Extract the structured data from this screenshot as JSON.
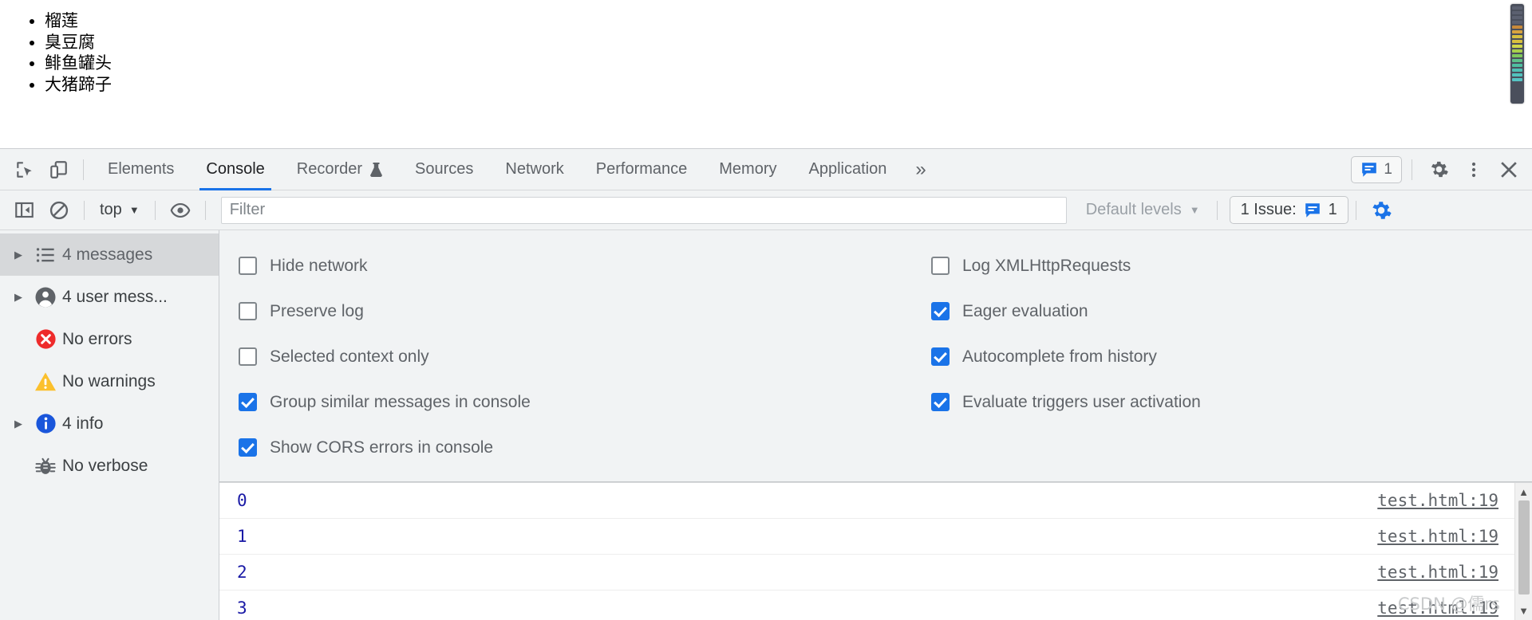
{
  "page": {
    "list_items": [
      "榴莲",
      "臭豆腐",
      "鲱鱼罐头",
      "大猪蹄子"
    ],
    "minimap_colors": [
      "#5b6070",
      "#5b6070",
      "#5b6070",
      "#5b6070",
      "#c98a3a",
      "#d8a33f",
      "#d8c03f",
      "#d8c03f",
      "#cfd84a",
      "#a8d04c",
      "#7fc95c",
      "#5cc28a",
      "#4fbfa0",
      "#4fc0b4",
      "#52c2bd",
      "#55c4c4"
    ]
  },
  "tabbar": {
    "inspect_icon": "inspect-element-icon",
    "device_icon": "device-toolbar-icon",
    "tabs": [
      {
        "label": "Elements",
        "active": false,
        "flask": false
      },
      {
        "label": "Console",
        "active": true,
        "flask": false
      },
      {
        "label": "Recorder",
        "active": false,
        "flask": true
      },
      {
        "label": "Sources",
        "active": false,
        "flask": false
      },
      {
        "label": "Network",
        "active": false,
        "flask": false
      },
      {
        "label": "Performance",
        "active": false,
        "flask": false
      },
      {
        "label": "Memory",
        "active": false,
        "flask": false
      },
      {
        "label": "Application",
        "active": false,
        "flask": false
      }
    ],
    "more_tabs": "»",
    "issues_badge_count": "1",
    "settings_icon": "gear-icon",
    "kebab_icon": "more-options-icon",
    "close_icon": "close-icon"
  },
  "filterbar": {
    "sidebar_toggle_icon": "console-sidebar-toggle-icon",
    "clear_icon": "clear-console-icon",
    "context": "top",
    "context_caret": "▼",
    "eye_icon": "live-expression-icon",
    "filter_value": "",
    "filter_placeholder": "Filter",
    "levels_label": "Default levels",
    "levels_caret": "▼",
    "issue_counter_label": "1 Issue:",
    "issue_counter_count": "1",
    "settings_gear_icon": "console-settings-gear-icon",
    "accent_color": "#1a73e8"
  },
  "sidebar": {
    "items": [
      {
        "label": "4 messages",
        "icon": "list-icon",
        "arrow": true,
        "selected": true
      },
      {
        "label": "4 user mess...",
        "icon": "user-icon",
        "arrow": true,
        "selected": false
      },
      {
        "label": "No errors",
        "icon": "error-icon",
        "arrow": false,
        "selected": false
      },
      {
        "label": "No warnings",
        "icon": "warning-icon",
        "arrow": false,
        "selected": false
      },
      {
        "label": "4 info",
        "icon": "info-icon",
        "arrow": true,
        "selected": false
      },
      {
        "label": "No verbose",
        "icon": "bug-icon",
        "arrow": false,
        "selected": false
      }
    ]
  },
  "settings": {
    "left_column": [
      {
        "label": "Hide network",
        "checked": false
      },
      {
        "label": "Preserve log",
        "checked": false
      },
      {
        "label": "Selected context only",
        "checked": false
      },
      {
        "label": "Group similar messages in console",
        "checked": true
      },
      {
        "label": "Show CORS errors in console",
        "checked": true
      }
    ],
    "right_column": [
      {
        "label": "Log XMLHttpRequests",
        "checked": false
      },
      {
        "label": "Eager evaluation",
        "checked": true
      },
      {
        "label": "Autocomplete from history",
        "checked": true
      },
      {
        "label": "Evaluate triggers user activation",
        "checked": true
      }
    ]
  },
  "console_log": {
    "rows": [
      {
        "value": "0",
        "source": "test.html:19"
      },
      {
        "value": "1",
        "source": "test.html:19"
      },
      {
        "value": "2",
        "source": "test.html:19"
      },
      {
        "value": "3",
        "source": "test.html:19"
      }
    ],
    "scroll_up": "▲",
    "scroll_down": "▼"
  },
  "watermark": "CSDN @儒rs"
}
